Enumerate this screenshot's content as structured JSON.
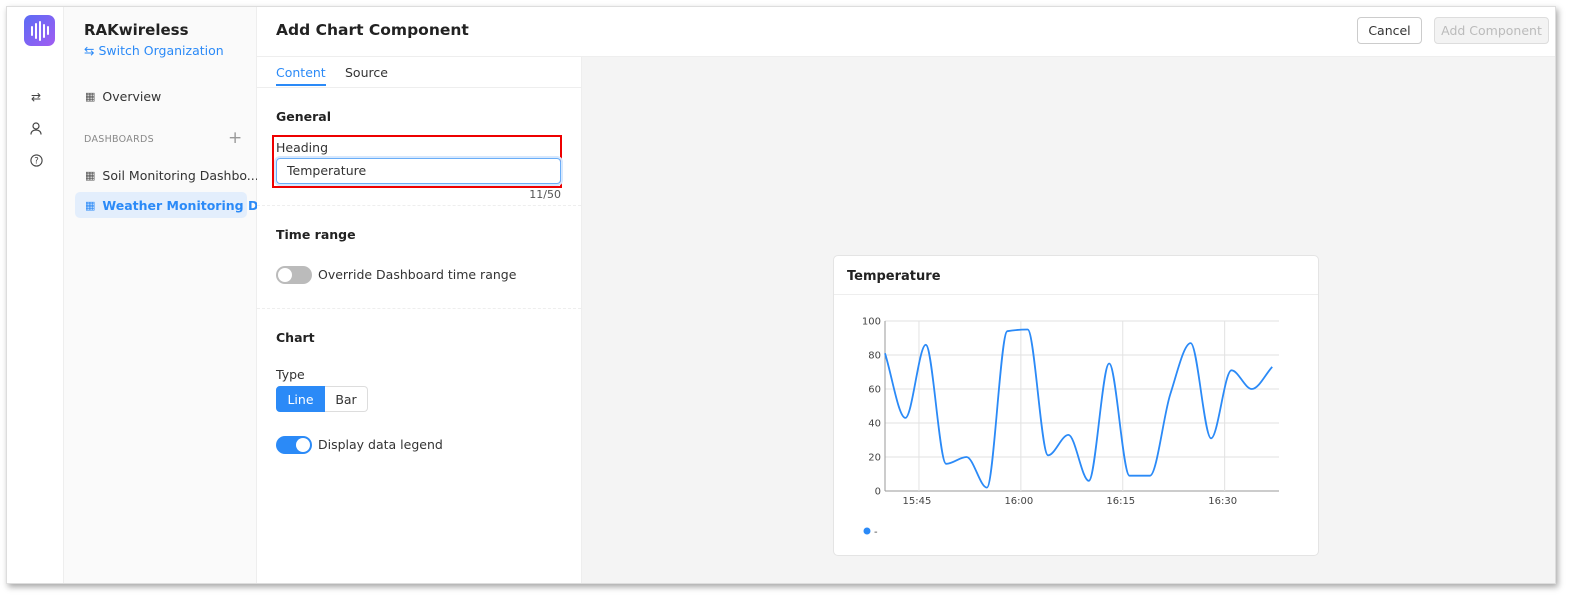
{
  "sidebar": {
    "org": "RAKwireless",
    "switch_label": "Switch Organization",
    "overview": "Overview",
    "dashboards_heading": "DASHBOARDS",
    "dashboards": [
      {
        "label": "Soil Monitoring Dashbo..."
      },
      {
        "label": "Weather Monitoring D...",
        "active": true
      }
    ]
  },
  "rail": {
    "icons": [
      "swap-icon",
      "user-icon",
      "help-icon"
    ]
  },
  "header": {
    "title": "Add Chart Component",
    "cancel": "Cancel",
    "add": "Add Component"
  },
  "tabs": [
    {
      "label": "Content",
      "active": true
    },
    {
      "label": "Source"
    }
  ],
  "form": {
    "general": "General",
    "heading_label": "Heading",
    "heading_value": "Temperature",
    "heading_count": "11/50",
    "time_range": "Time range",
    "override_label": "Override Dashboard time range",
    "override_on": false,
    "chart": "Chart",
    "type_label": "Type",
    "type_options": [
      "Line",
      "Bar"
    ],
    "type_selected": "Line",
    "legend_label": "Display data legend",
    "legend_on": true
  },
  "colors": {
    "accent": "#2b8af7",
    "highlight": "#e00000"
  },
  "chart_data": {
    "type": "line",
    "title": "Temperature",
    "curve": "smooth",
    "x": [
      "15:40",
      "15:43",
      "15:46",
      "15:49",
      "15:52",
      "15:55",
      "15:58",
      "16:01",
      "16:04",
      "16:07",
      "16:10",
      "16:13",
      "16:16",
      "16:19",
      "16:22",
      "16:25",
      "16:28",
      "16:31",
      "16:34",
      "16:37"
    ],
    "values": [
      81,
      43,
      86,
      16,
      20,
      2,
      94,
      95,
      21,
      33,
      6,
      75,
      9,
      9,
      57,
      87,
      31,
      71,
      60,
      73
    ],
    "xlim": [
      "15:40",
      "16:38"
    ],
    "ylim": [
      0,
      100
    ],
    "yticks": [
      0,
      20,
      40,
      60,
      80,
      100
    ],
    "xticks": [
      "15:45",
      "16:00",
      "16:15",
      "16:30"
    ],
    "grid": true,
    "legend": [
      {
        "name": "-"
      }
    ],
    "legend_placement": "bottom-left",
    "color": "#2b8af7"
  }
}
